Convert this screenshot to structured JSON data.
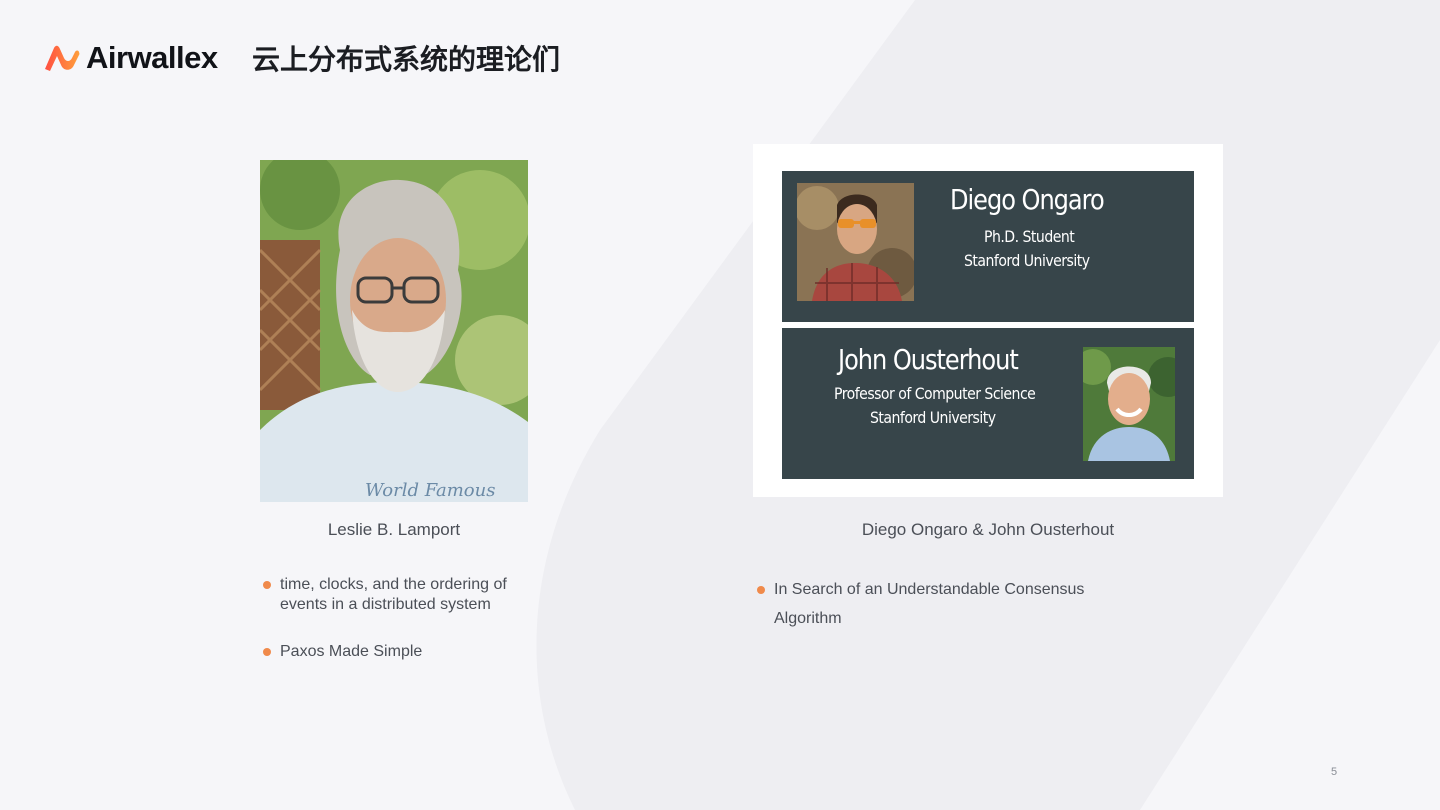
{
  "brand": {
    "name": "Airwallex",
    "accent_start": "#ff4f42",
    "accent_end": "#ff9f3b"
  },
  "slide": {
    "title": "云上分布式系统的理论们",
    "page_number": "5"
  },
  "left": {
    "photo_icon": "person-photo",
    "caption": "Leslie B. Lamport",
    "bullets": [
      "time, clocks, and the ordering of events in a distributed system",
      "Paxos Made Simple"
    ]
  },
  "right": {
    "card": {
      "top": {
        "name": "Diego Ongaro",
        "role": "Ph.D. Student",
        "affiliation": "Stanford University"
      },
      "bottom": {
        "name": "John Ousterhout",
        "role": "Professor of Computer Science",
        "affiliation": "Stanford University"
      },
      "panel_color": "#37454a"
    },
    "caption": "Diego Ongaro & John Ousterhout",
    "bullets": [
      "In Search of an Understandable Consensus Algorithm"
    ]
  },
  "colors": {
    "bullet": "#f08a4b",
    "background": "#f6f6f9"
  }
}
